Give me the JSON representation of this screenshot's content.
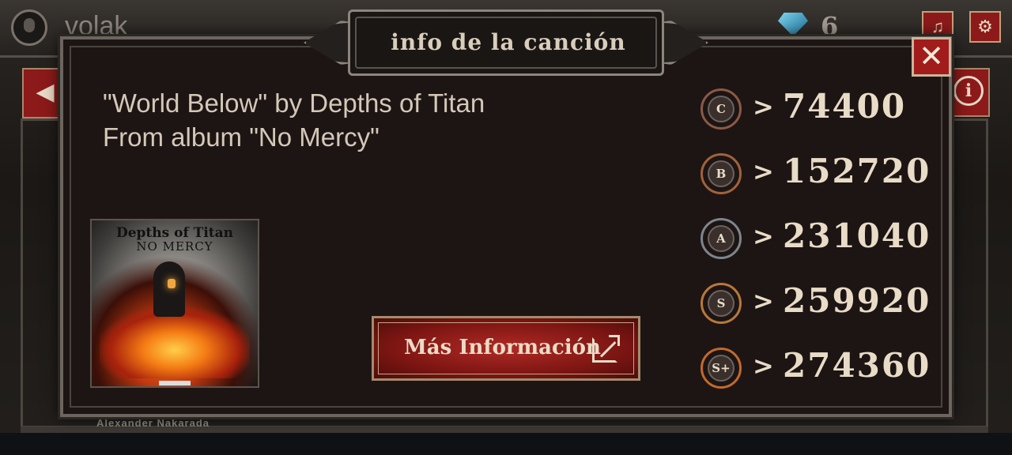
{
  "background": {
    "username": "volak",
    "gem_count": "6",
    "list_bottom_name": "Alexander Nakarada",
    "info_button": "i",
    "back_arrow": "◀",
    "music_icon": "music-note-icon",
    "settings_icon": "gear-icon"
  },
  "modal": {
    "title": "info de la canción",
    "close_label": "✕",
    "song_line1": "\"World Below\" by Depths of Titan",
    "song_line2": "From album \"No Mercy\"",
    "cover": {
      "artist": "Depths of Titan",
      "album": "NO MERCY"
    },
    "more_info_label": "Más Información",
    "ranks": [
      {
        "grade": "C",
        "symbol": ">",
        "score": "74400",
        "color": "#8a5a45"
      },
      {
        "grade": "B",
        "symbol": ">",
        "score": "152720",
        "color": "#a2623a"
      },
      {
        "grade": "A",
        "symbol": ">",
        "score": "231040",
        "color": "#7e858c"
      },
      {
        "grade": "S",
        "symbol": ">",
        "score": "259920",
        "color": "#b8783a"
      },
      {
        "grade": "S+",
        "symbol": ">",
        "score": "274360",
        "color": "#c26a2a"
      }
    ]
  },
  "colors": {
    "accent_red": "#a21c1c",
    "panel_bg": "#1d1514",
    "text_cream": "#e9dcc7"
  }
}
